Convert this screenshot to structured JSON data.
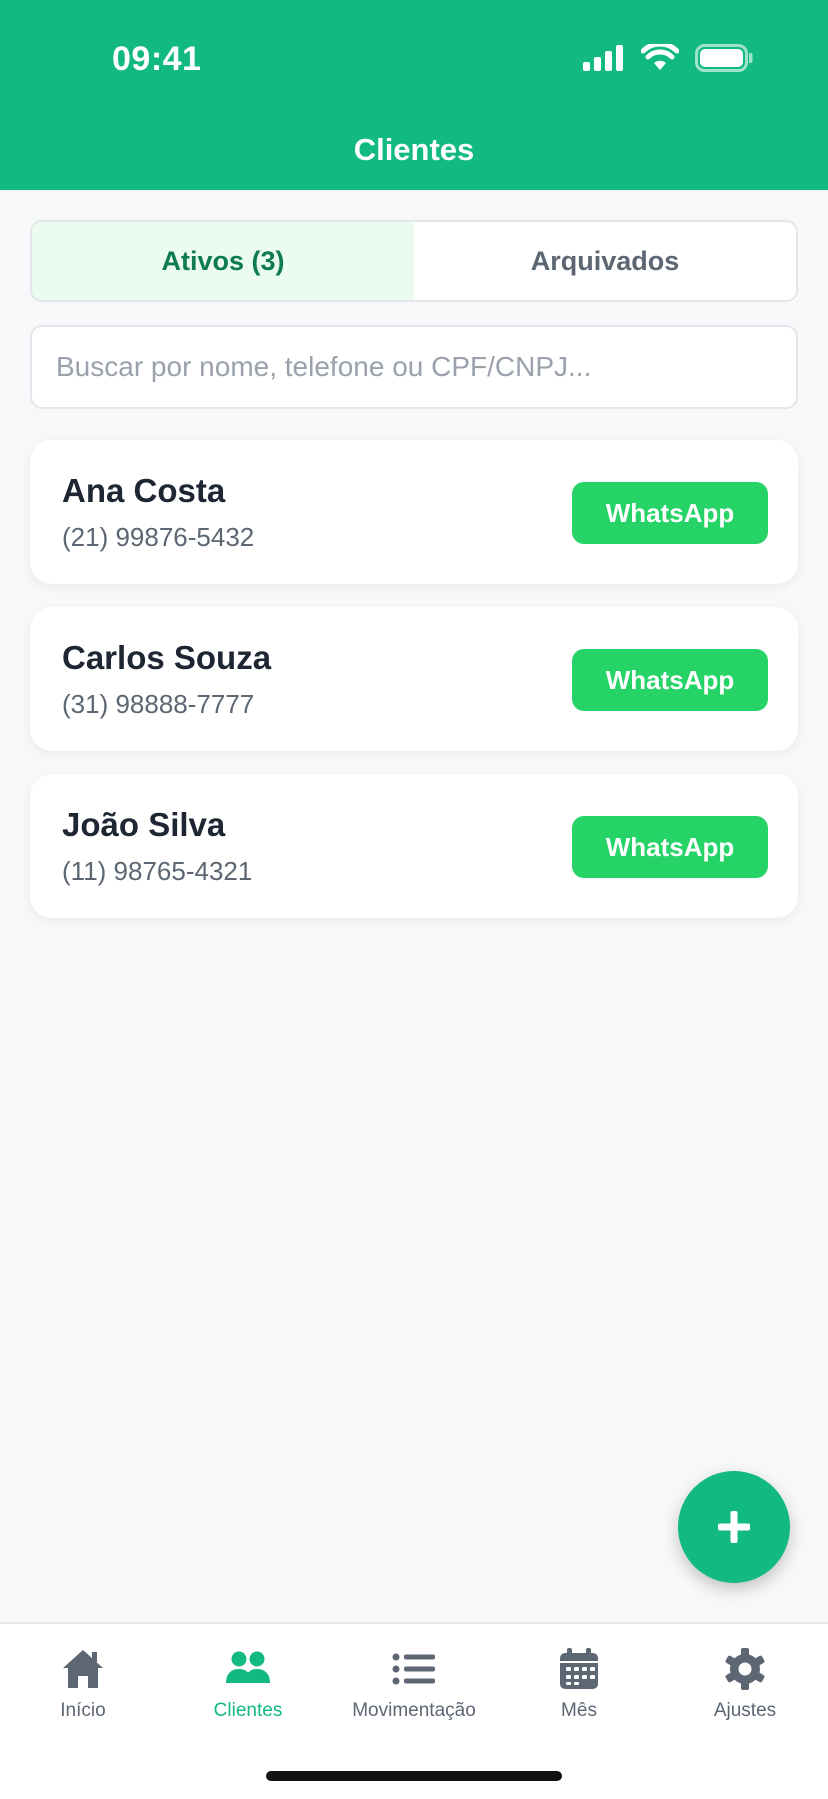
{
  "status_bar": {
    "time": "09:41"
  },
  "header": {
    "title": "Clientes"
  },
  "tabs": [
    {
      "label": "Ativos (3)",
      "active": true
    },
    {
      "label": "Arquivados",
      "active": false
    }
  ],
  "search": {
    "placeholder": "Buscar por nome, telefone ou CPF/CNPJ...",
    "value": ""
  },
  "clients": [
    {
      "name": "Ana Costa",
      "phone": "(21) 99876-5432",
      "action_label": "WhatsApp"
    },
    {
      "name": "Carlos Souza",
      "phone": "(31) 98888-7777",
      "action_label": "WhatsApp"
    },
    {
      "name": "João Silva",
      "phone": "(11) 98765-4321",
      "action_label": "WhatsApp"
    }
  ],
  "fab": {
    "icon": "plus-icon"
  },
  "bottom_nav": [
    {
      "label": "Início",
      "icon": "home-icon",
      "active": false
    },
    {
      "label": "Clientes",
      "icon": "users-icon",
      "active": true
    },
    {
      "label": "Movimentação",
      "icon": "list-icon",
      "active": false
    },
    {
      "label": "Mês",
      "icon": "calendar-icon",
      "active": false
    },
    {
      "label": "Ajustes",
      "icon": "gear-icon",
      "active": false
    }
  ],
  "colors": {
    "primary": "#12b981",
    "whatsapp": "#25d366",
    "active_tab_bg": "#ebfbf2",
    "active_tab_text": "#0e7a53",
    "muted_text": "#5d6673"
  }
}
